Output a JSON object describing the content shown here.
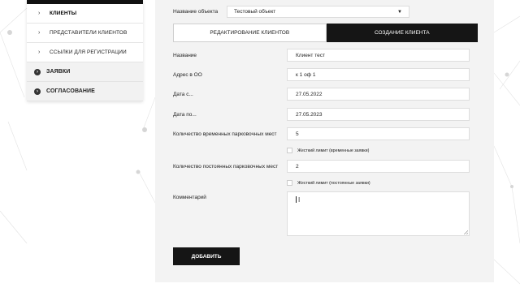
{
  "sidebar": {
    "items": [
      {
        "label": "Клиенты",
        "active": true
      },
      {
        "label": "Представители клиентов",
        "active": false
      },
      {
        "label": "Ссылки для регистрации",
        "active": false
      }
    ],
    "main_items": [
      {
        "label": "Заявки"
      },
      {
        "label": "Согласование"
      }
    ]
  },
  "object": {
    "label": "Название объекта",
    "value": "Тестовый объект"
  },
  "tabs": [
    {
      "label": "Редактирование клиентов",
      "active": false
    },
    {
      "label": "Создание клиента",
      "active": true
    }
  ],
  "form": {
    "name": {
      "label": "Название",
      "value": "Клиент тест"
    },
    "address": {
      "label": "Адрес в ОО",
      "value": "к 1 оф 1"
    },
    "date_from": {
      "label": "Дата с...",
      "value": "27.05.2022"
    },
    "date_to": {
      "label": "Дата по...",
      "value": "27.05.2023"
    },
    "temp_places": {
      "label": "Количество временных парковочных мест",
      "value": "5"
    },
    "temp_limit": {
      "label": "Жесткий лимит (временные заявки)",
      "checked": false
    },
    "perm_places": {
      "label": "Количество постоянных парковочных мест",
      "value": "2"
    },
    "perm_limit": {
      "label": "Жесткий лимит (постоянные заявки)",
      "checked": false
    },
    "comment": {
      "label": "Комментарий",
      "value": ""
    }
  },
  "buttons": {
    "add": "Добавить"
  }
}
